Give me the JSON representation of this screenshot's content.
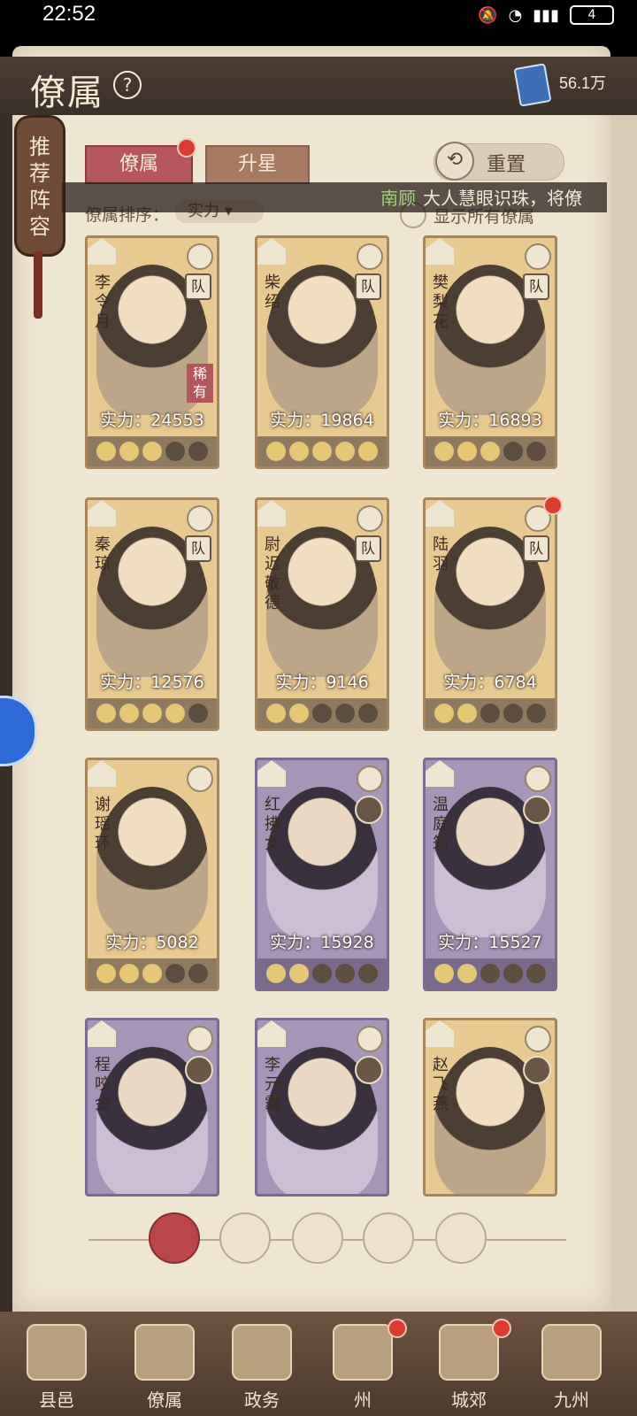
{
  "status_bar": {
    "time": "22:52",
    "battery": "4"
  },
  "header": {
    "title": "僚属",
    "currency_value": "56.1万"
  },
  "banner": {
    "text": "推荐阵容"
  },
  "tabs": [
    {
      "label": "僚属"
    },
    {
      "label": "升星"
    }
  ],
  "reset": {
    "label": "重置"
  },
  "marquee": {
    "name": "南顾",
    "message": "大人慧眼识珠，将僚"
  },
  "sort": {
    "label": "僚属排序：",
    "value": "实力"
  },
  "show_all": {
    "label": "显示所有僚属"
  },
  "cards": [
    {
      "name": "李令月",
      "power": "实力：24553",
      "tag": "队",
      "rare": "稀有"
    },
    {
      "name": "柴绍",
      "power": "实力：19864",
      "tag": "队"
    },
    {
      "name": "樊梨花",
      "power": "实力：16893",
      "tag": "队"
    },
    {
      "name": "秦琼",
      "power": "实力：12576",
      "tag": "队"
    },
    {
      "name": "尉迟敬德",
      "power": "实力：9146",
      "tag": "队"
    },
    {
      "name": "陆羽",
      "power": "实力：6784",
      "tag": "队"
    },
    {
      "name": "谢瑶环",
      "power": "实力：5082"
    },
    {
      "name": "红拂女",
      "power": "实力：15928"
    },
    {
      "name": "温庭筠",
      "power": "实力：15527"
    },
    {
      "name": "程咬金"
    },
    {
      "name": "李元霸"
    },
    {
      "name": "赵飞燕"
    }
  ],
  "card_stars": [
    3,
    5,
    3,
    4,
    2,
    2,
    3,
    2,
    2,
    0,
    0,
    0
  ],
  "bottom_nav": [
    {
      "label": "县邑"
    },
    {
      "label": "僚属"
    },
    {
      "label": "政务"
    },
    {
      "label": "州"
    },
    {
      "label": "城郊"
    },
    {
      "label": "九州"
    }
  ]
}
